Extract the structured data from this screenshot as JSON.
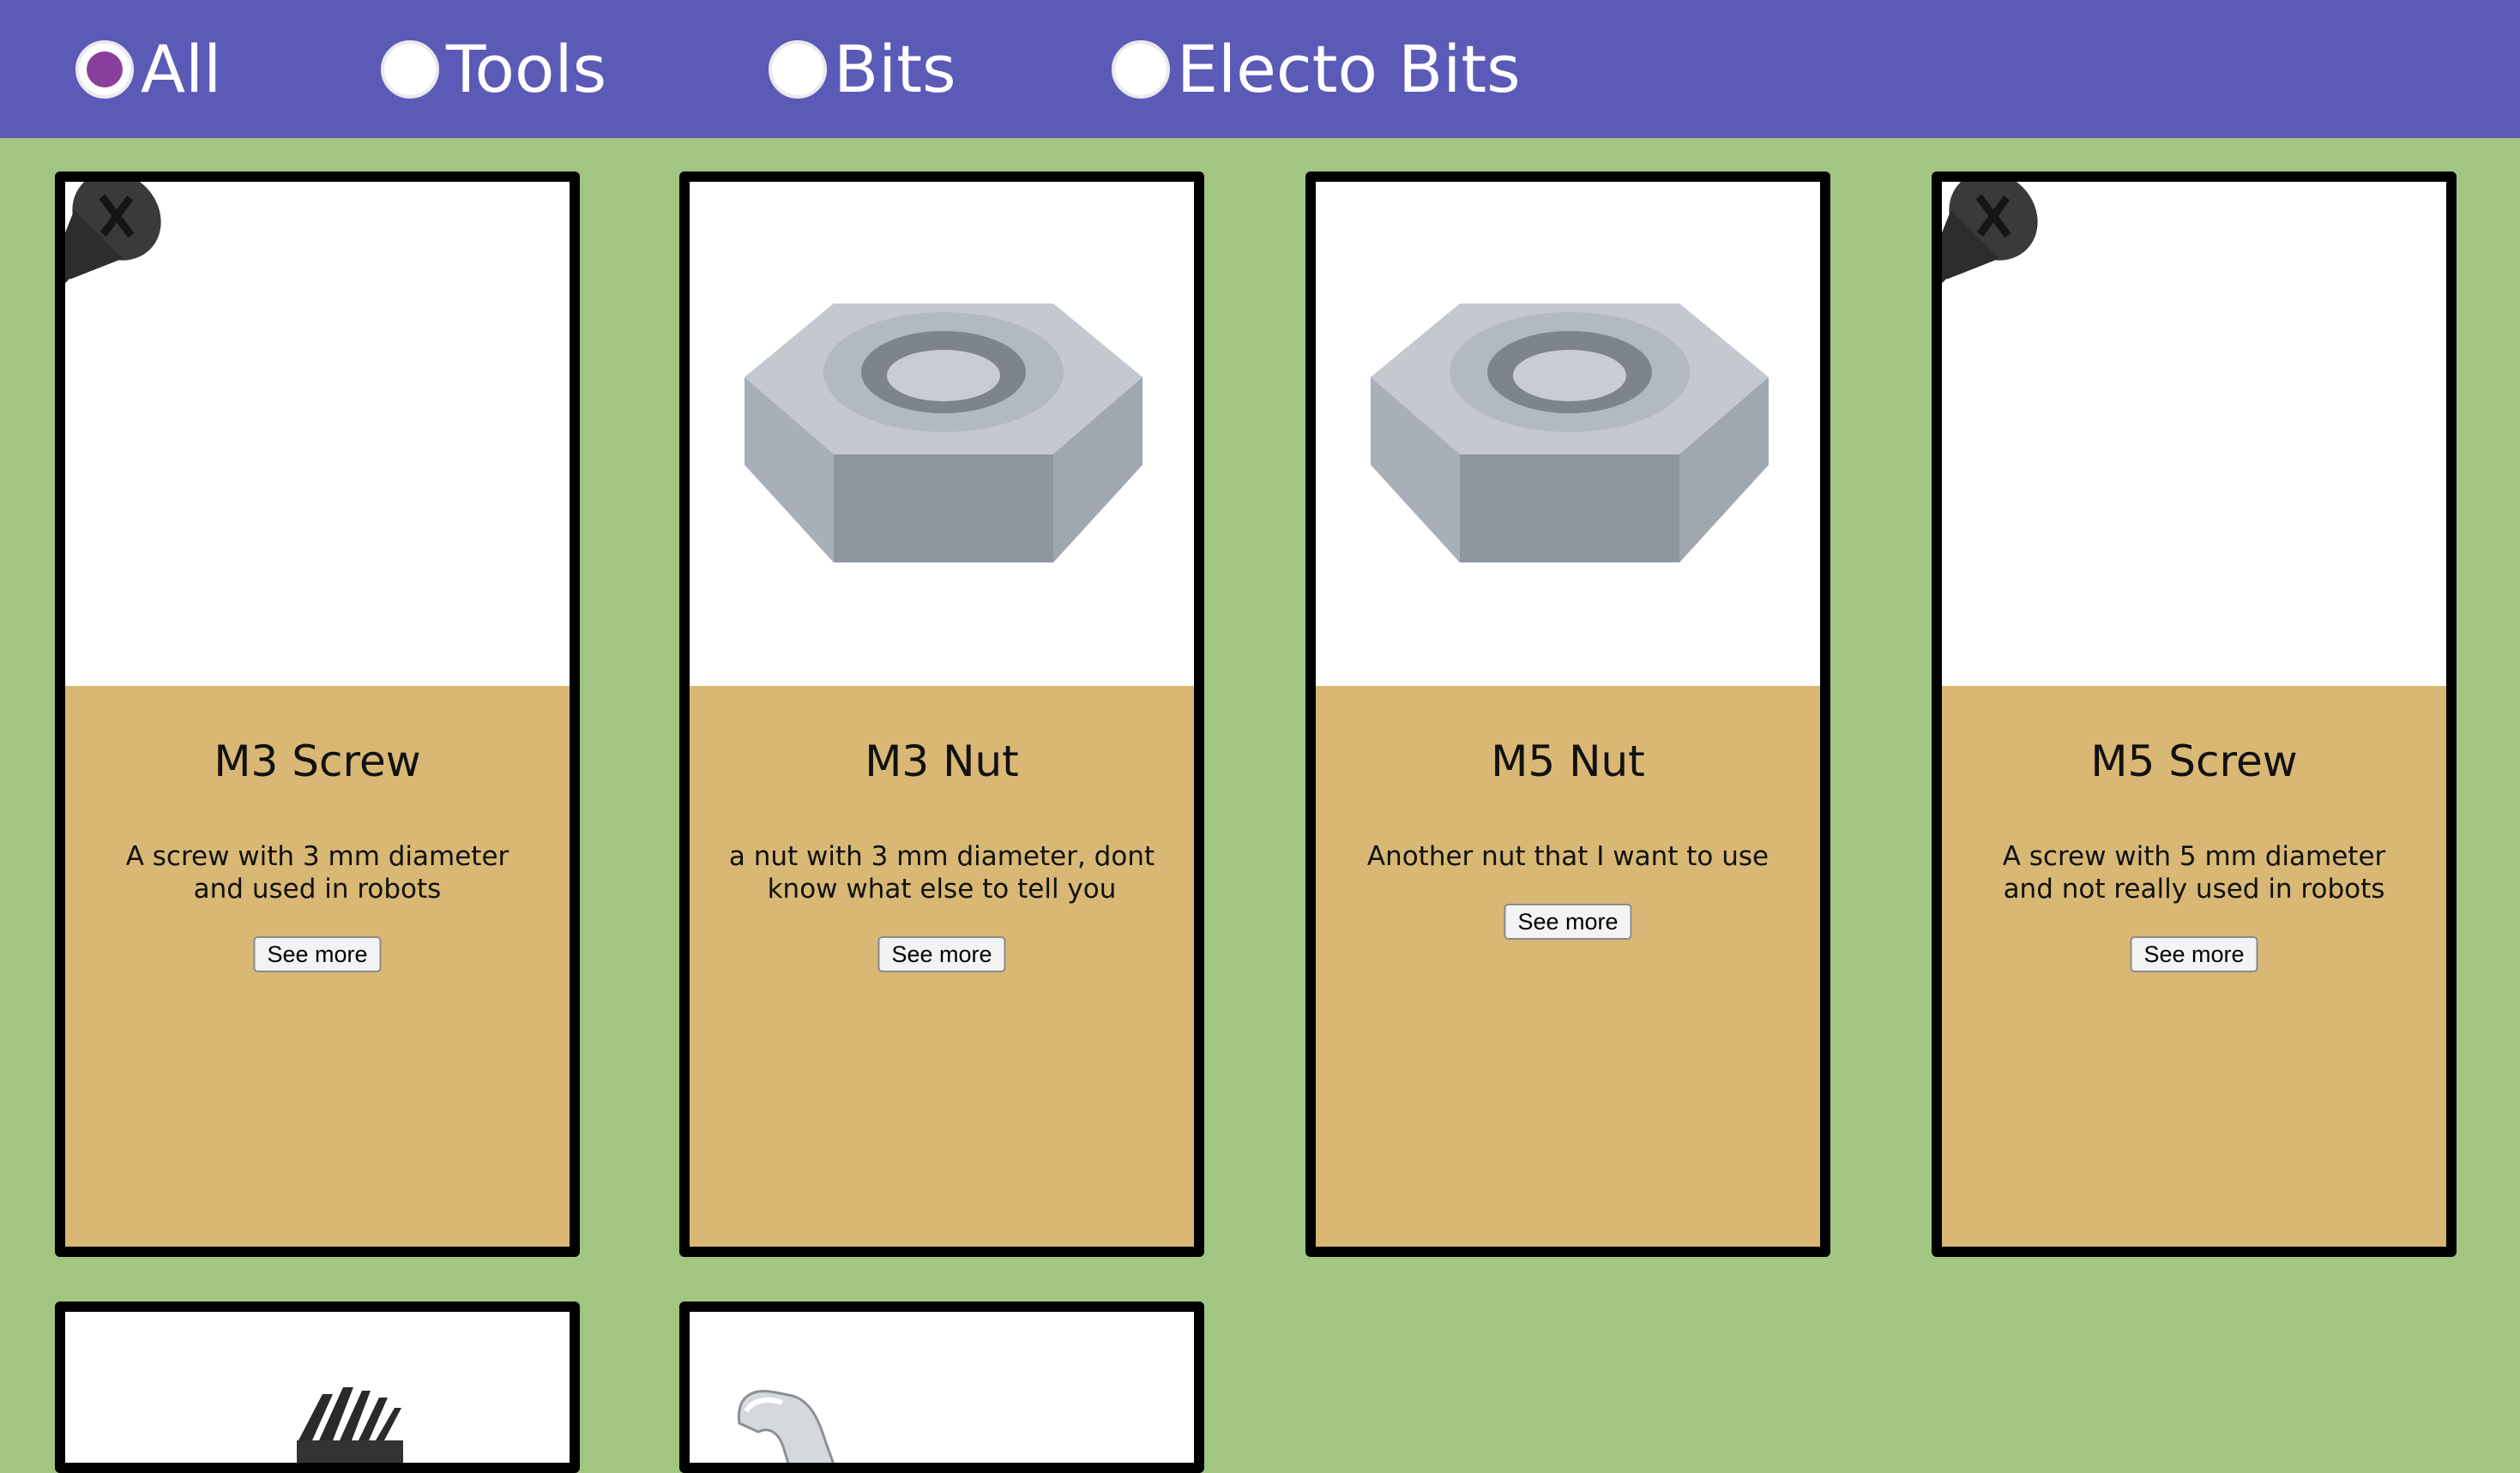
{
  "filters": {
    "accent": "#8b3f9c",
    "options": [
      {
        "label": "All",
        "checked": true
      },
      {
        "label": "Tools",
        "checked": false
      },
      {
        "label": "Bits",
        "checked": false
      },
      {
        "label": "Electo Bits",
        "checked": false
      }
    ]
  },
  "products": [
    {
      "title": "M3 Screw",
      "description": "A screw with 3 mm diameter and used in robots",
      "button": "See more",
      "icon": "screw-icon"
    },
    {
      "title": "M3 Nut",
      "description": "a nut with 3 mm diameter, dont know what else to tell you",
      "button": "See more",
      "icon": "nut-icon"
    },
    {
      "title": "M5 Nut",
      "description": "Another nut that I want to use",
      "button": "See more",
      "icon": "nut-icon"
    },
    {
      "title": "M5 Screw",
      "description": "A screw with 5 mm diameter and not really used in robots",
      "button": "See more",
      "icon": "screw-icon"
    },
    {
      "icon": "heatsink-icon"
    },
    {
      "icon": "wrench-icon"
    }
  ],
  "colors": {
    "page_background": "#a2c582",
    "header": "#5b5ab7",
    "card_body": "#d8b874",
    "card_border": "#000000"
  }
}
